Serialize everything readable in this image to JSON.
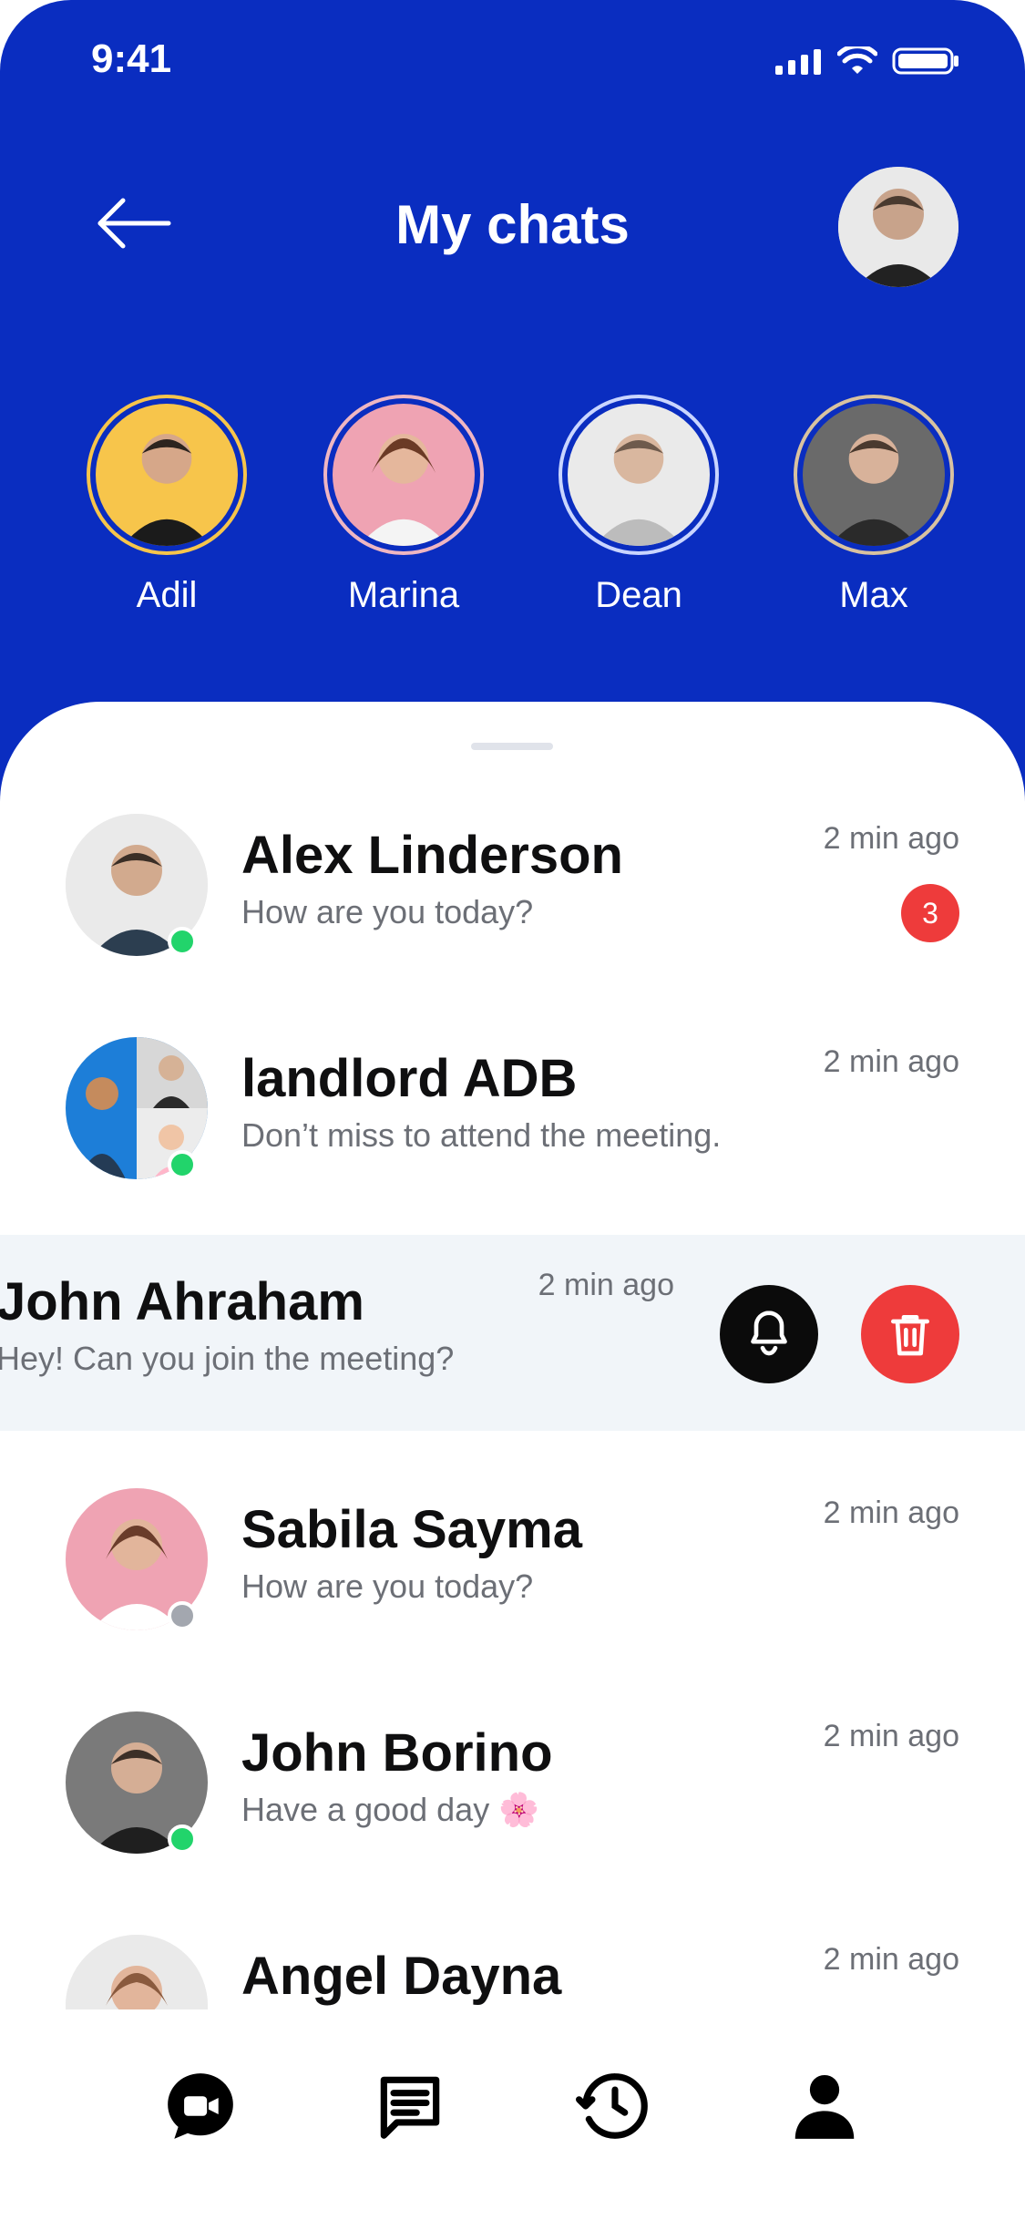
{
  "status": {
    "time": "9:41"
  },
  "header": {
    "title": "My chats"
  },
  "stories": [
    {
      "name": "Adil"
    },
    {
      "name": "Marina"
    },
    {
      "name": "Dean"
    },
    {
      "name": "Max"
    }
  ],
  "chats": [
    {
      "name": "Alex Linderson",
      "message": "How are you today?",
      "time": "2 min ago",
      "unread": "3",
      "online": true
    },
    {
      "name": "landlord ADB",
      "message": "Don’t miss to attend the meeting.",
      "time": "2 min ago",
      "online": true
    },
    {
      "name": "John Ahraham",
      "message": "Hey! Can you join the meeting?",
      "time": "2 min ago",
      "swiped": true
    },
    {
      "name": "Sabila Sayma",
      "message": "How are you today?",
      "time": "2 min ago",
      "online": false
    },
    {
      "name": "John Borino",
      "message": "Have a good day 🌸",
      "time": "2 min ago",
      "online": true
    },
    {
      "name": "Angel Dayna",
      "message": "",
      "time": "2 min ago"
    }
  ],
  "colors": {
    "primary": "#0A2DC0",
    "danger": "#EE3B3B",
    "online": "#22D46B",
    "offline": "#A3A7AF"
  },
  "nav": [
    {
      "icon": "video-chat-icon"
    },
    {
      "icon": "chat-icon"
    },
    {
      "icon": "history-icon"
    },
    {
      "icon": "profile-icon"
    }
  ]
}
